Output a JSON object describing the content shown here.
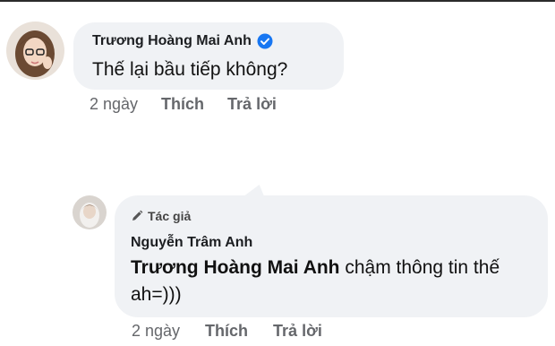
{
  "comments": [
    {
      "author": "Trương Hoàng Mai Anh",
      "verified": true,
      "text": "Thế lại bầu tiếp không?",
      "time": "2 ngày",
      "like_label": "Thích",
      "reply_label": "Trả lời"
    },
    {
      "badge": "Tác giả",
      "author": "Nguyễn Trâm Anh",
      "mention": "Trương Hoàng Mai Anh",
      "text": " chậm thông tin thế ah=)))",
      "time": "2 ngày",
      "like_label": "Thích",
      "reply_label": "Trả lời"
    }
  ],
  "colors": {
    "bubble": "#f0f2f5",
    "meta_text": "#65676b",
    "verified": "#1877f2"
  },
  "icons": [
    "avatar",
    "verified-badge-icon",
    "pencil-icon"
  ]
}
